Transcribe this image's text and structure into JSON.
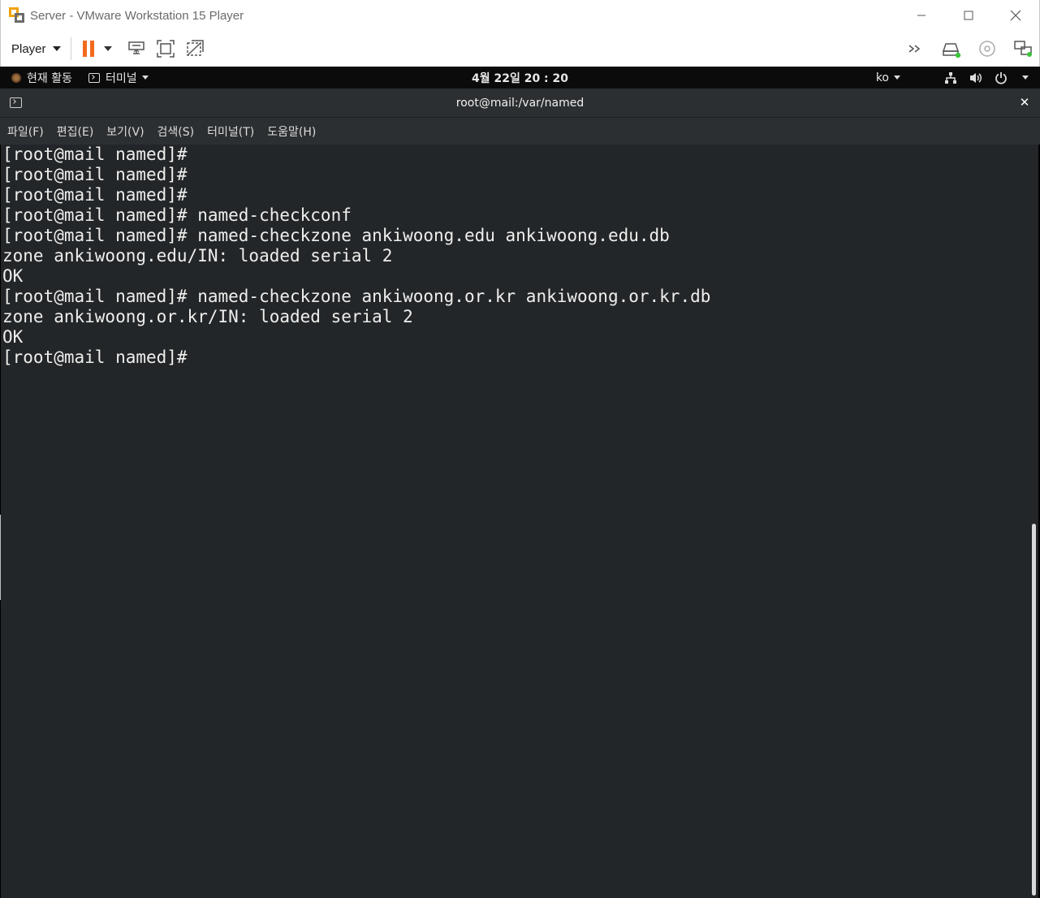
{
  "window": {
    "title": "Server - VMware Workstation 15 Player",
    "controls": {
      "minimize": "minimize-icon",
      "maximize": "maximize-icon",
      "close": "close-icon"
    }
  },
  "toolbar": {
    "player_label": "Player",
    "icons": [
      "pause-icon",
      "send-ctrl-alt-del-icon",
      "full-screen-icon",
      "unity-icon"
    ],
    "right_icons": [
      "more-chevrons-icon",
      "hard-disk-icon",
      "cd-dvd-icon",
      "network-adapter-icon"
    ]
  },
  "gnome": {
    "activities": "현재 활동",
    "app_menu": "터미널",
    "clock": "4월 22일  20 : 20",
    "input_method": "ko",
    "tray": [
      "network-icon",
      "volume-icon",
      "power-icon"
    ]
  },
  "terminal": {
    "title": "root@mail:/var/named",
    "menu": [
      "파일(F)",
      "편집(E)",
      "보기(V)",
      "검색(S)",
      "터미널(T)",
      "도움말(H)"
    ],
    "lines": [
      "[root@mail named]#",
      "[root@mail named]#",
      "[root@mail named]#",
      "[root@mail named]# named-checkconf",
      "[root@mail named]# named-checkzone ankiwoong.edu ankiwoong.edu.db",
      "zone ankiwoong.edu/IN: loaded serial 2",
      "OK",
      "[root@mail named]# named-checkzone ankiwoong.or.kr ankiwoong.or.kr.db",
      "zone ankiwoong.or.kr/IN: loaded serial 2",
      "OK",
      "[root@mail named]#"
    ]
  },
  "colors": {
    "terminal_bg": "#232629",
    "terminal_fg": "#eeeeec",
    "header_bg": "#2c2f31",
    "gnome_bar_bg": "#0b0b0b",
    "pause_accent": "#f26b1d"
  }
}
